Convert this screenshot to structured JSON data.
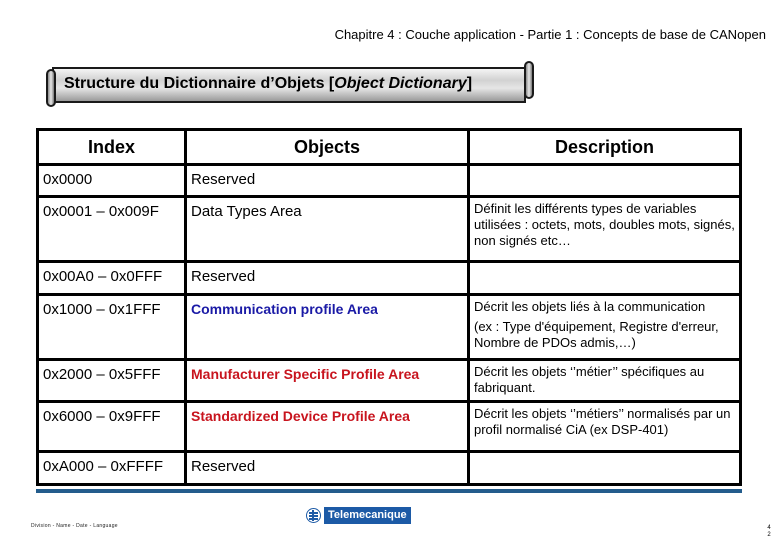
{
  "header": {
    "chapter": "Chapitre 4 : Couche application - Partie 1 : Concepts de base de CANopen"
  },
  "title": {
    "main": "Structure du Dictionnaire d’Objets [",
    "italic": "Object Dictionary",
    "close": "]"
  },
  "table": {
    "headers": [
      "Index",
      "Objects",
      "Description"
    ],
    "rows": [
      {
        "index": "0x0000",
        "object": "Reserved",
        "object_color": "black",
        "description": "",
        "description_extra": ""
      },
      {
        "index": "0x0001 – 0x009F",
        "object": "Data Types Area",
        "object_color": "black",
        "description": "Définit les différents types de variables utilisées : octets, mots, doubles mots, signés, non signés etc…",
        "description_extra": ""
      },
      {
        "index": "0x00A0 – 0x0FFF",
        "object": "Reserved",
        "object_color": "black",
        "description": "",
        "description_extra": ""
      },
      {
        "index": "0x1000 – 0x1FFF",
        "object": "Communication profile Area",
        "object_color": "#1a1aa6",
        "description": "Décrit les objets liés à la communication",
        "description_extra": "(ex : Type d'équipement, Registre d'erreur, Nombre de PDOs admis,…)"
      },
      {
        "index": "0x2000 – 0x5FFF",
        "object": "Manufacturer Specific Profile Area",
        "object_color": "#c8141e",
        "description": "Décrit les objets ‘’métier’’ spécifiques au fabriquant.",
        "description_extra": ""
      },
      {
        "index": "0x6000 – 0x9FFF",
        "object": "Standardized Device Profile Area",
        "object_color": "#c8141e",
        "description": "Décrit les objets ‘’métiers’’ normalisés par un profil normalisé CiA (ex DSP-401)",
        "description_extra": ""
      },
      {
        "index": "0xA000 – 0xFFFF",
        "object": "Reserved",
        "object_color": "black",
        "description": "",
        "description_extra": ""
      }
    ]
  },
  "footer": {
    "left": "Division - Name - Date - Language",
    "logo_text": "Telemecanique",
    "logo_icon": "telemecanique-logo-icon",
    "page": "4 2",
    "rule_color": "#235c8c"
  }
}
